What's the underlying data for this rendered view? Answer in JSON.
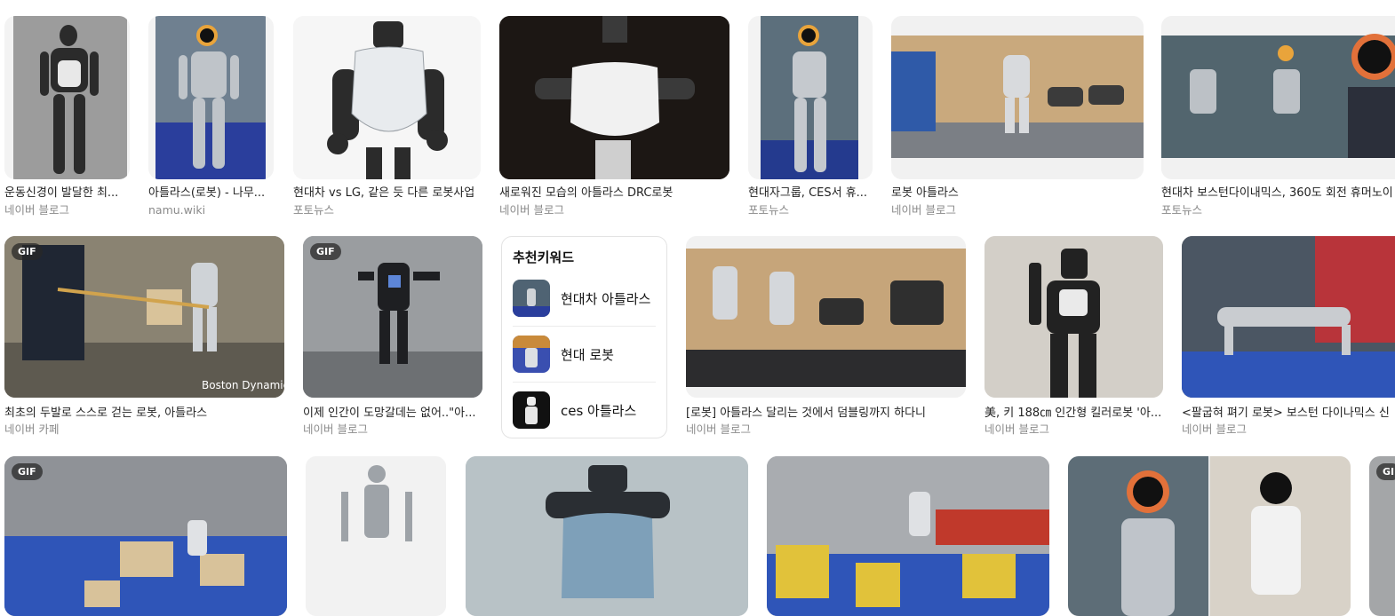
{
  "cards_row1": [
    {
      "title": "운동신경이 발달한 최...",
      "source": "네이버 블로그",
      "icon": "robot-atlas-image"
    },
    {
      "title": "아틀라스(로봇) - 나무...",
      "source": "namu.wiki",
      "icon": "robot-atlas-image"
    },
    {
      "title": "현대차 vs LG, 같은 듯 다른 로봇사업",
      "source": "포토뉴스",
      "icon": "robot-atlas-image"
    },
    {
      "title": "새로워진 모습의 아틀라스 DRC로봇",
      "source": "네이버 블로그",
      "icon": "robot-atlas-image"
    },
    {
      "title": "현대자그룹, CES서 휴...",
      "source": "포토뉴스",
      "icon": "robot-atlas-image"
    },
    {
      "title": "로봇 아틀라스",
      "source": "네이버 블로그",
      "icon": "robot-atlas-image"
    },
    {
      "title": "현대차 보스턴다이내믹스, 360도 회전 휴머노이",
      "source": "포토뉴스",
      "icon": "robot-atlas-image"
    }
  ],
  "cards_row2": [
    {
      "title": "최초의 두발로 스스로 걷는 로봇, 아틀라스",
      "source": "네이버 카페",
      "badge": "GIF",
      "watermark": "Boston Dynamics"
    },
    {
      "title": "이제 인간이 도망갈데는 없어..\"아...",
      "source": "네이버 블로그",
      "badge": "GIF"
    },
    {
      "title": "[로봇] 아틀라스 달리는 것에서 덤블링까지 하다니",
      "source": "네이버 블로그"
    },
    {
      "title": "美, 키 188㎝ 인간형 킬러로봇 '아...",
      "source": "네이버 블로그"
    },
    {
      "title": "<팔굽혀 펴기 로봇> 보스턴 다이나믹스 신",
      "source": "네이버 블로그"
    }
  ],
  "cards_row3": [
    {
      "badge": "GIF"
    },
    {},
    {},
    {},
    {},
    {
      "badge": "GI"
    }
  ],
  "keywords": {
    "title": "추천키워드",
    "items": [
      {
        "label": "현대차 아틀라스"
      },
      {
        "label": "현대 로봇"
      },
      {
        "label": "ces 아틀라스"
      }
    ]
  },
  "colors": {
    "card_bg": "#f1f1f1",
    "title": "#222222",
    "source": "#8a8a8a",
    "border": "#e3e3e3"
  }
}
